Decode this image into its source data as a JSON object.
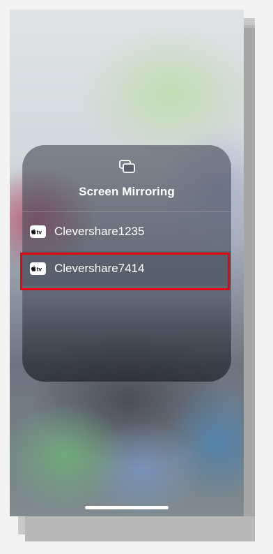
{
  "panel": {
    "icon": "screen-mirroring-icon",
    "title": "Screen Mirroring"
  },
  "devices": [
    {
      "label": "Clevershare1235",
      "icon": "apple-tv-icon",
      "selected": false
    },
    {
      "label": "Clevershare7414",
      "icon": "apple-tv-icon",
      "selected": true
    }
  ],
  "colors": {
    "highlight": "#e3060a",
    "text": "#ffffff"
  }
}
